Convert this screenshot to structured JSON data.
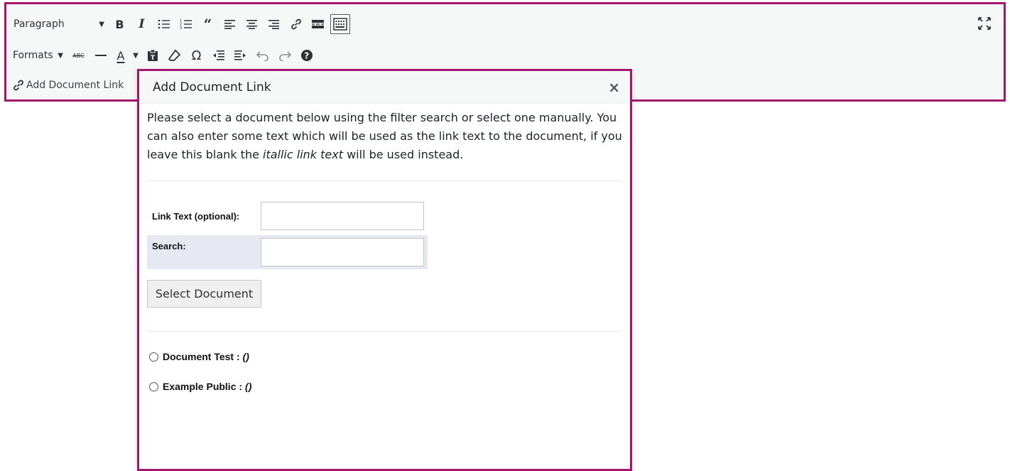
{
  "toolbar": {
    "format_select": "Paragraph",
    "formats_menu": "Formats",
    "bold_label": "B",
    "italic_label": "I",
    "strikethrough_label": "ABC",
    "text_color_label": "A",
    "special_char_label": "Ω",
    "add_document_link": "Add Document Link",
    "icons": [
      "bullet-list-icon",
      "numbered-list-icon",
      "blockquote-icon",
      "align-left-icon",
      "align-center-icon",
      "align-right-icon",
      "link-icon",
      "read-more-icon",
      "toolbar-toggle-icon",
      "fullscreen-icon",
      "horizontal-line-icon",
      "paste-text-icon",
      "clear-formatting-icon",
      "outdent-icon",
      "indent-icon",
      "undo-icon",
      "redo-icon",
      "help-icon"
    ]
  },
  "dialog": {
    "title": "Add Document Link",
    "close": "×",
    "intro_part1": "Please select a document below using the filter search or select one manually. You can also enter some text which will be used as the link text to the document, if you leave this blank the ",
    "intro_italic": "itallic link text",
    "intro_part2": " will be used instead.",
    "link_text_label": "Link Text (optional):",
    "link_text_value": "",
    "search_label": "Search:",
    "search_value": "",
    "select_button": "Select Document",
    "documents": [
      {
        "name": "Document Test :",
        "meta": "()"
      },
      {
        "name": "Example Public :",
        "meta": "()"
      }
    ]
  },
  "colors": {
    "highlight_border": "#a5166e",
    "toolbar_bg": "#f6f7f7",
    "search_row_bg": "#e6e9f2"
  }
}
